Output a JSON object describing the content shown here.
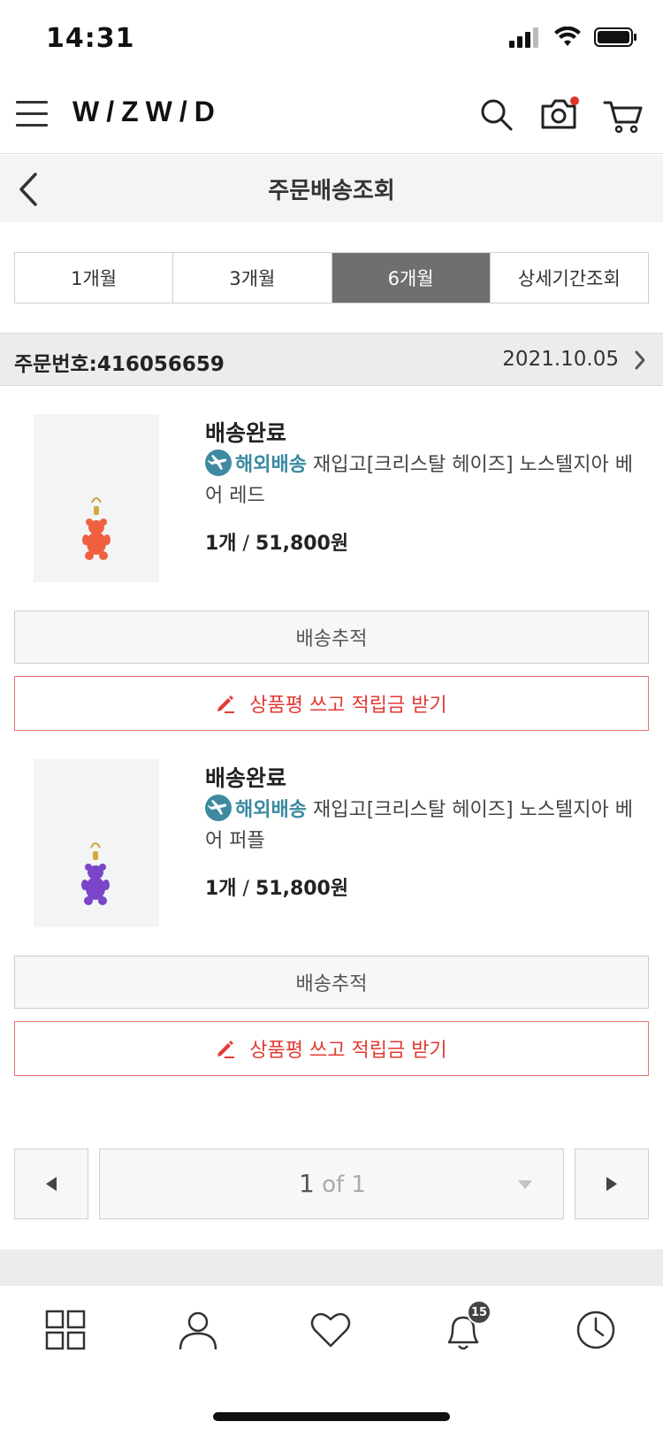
{
  "status_bar": {
    "time": "14:31"
  },
  "header": {
    "brand": "W/ZW/D"
  },
  "page": {
    "title": "주문배송조회"
  },
  "period_tabs": [
    {
      "label": "1개월",
      "active": false
    },
    {
      "label": "3개월",
      "active": false
    },
    {
      "label": "6개월",
      "active": true
    },
    {
      "label": "상세기간조회",
      "active": false
    }
  ],
  "order": {
    "number": "주문번호:416056659",
    "date": "2021.10.05"
  },
  "items": [
    {
      "status": "배송완료",
      "overseas_label": "해외배송",
      "name": "재입고[크리스탈 헤이즈] 노스텔지아 베어 레드",
      "qty": "1개",
      "price": "51,800원",
      "bear_color": "#f06040",
      "track_label": "배송추적",
      "review_label": "상품평 쓰고 적립금 받기"
    },
    {
      "status": "배송완료",
      "overseas_label": "해외배송",
      "name": "재입고[크리스탈 헤이즈] 노스텔지아 베어 퍼플",
      "qty": "1개",
      "price": "51,800원",
      "bear_color": "#7a45c8",
      "track_label": "배송추적",
      "review_label": "상품평 쓰고 적립금 받기"
    }
  ],
  "pagination": {
    "current": "1",
    "total_text": "of 1"
  },
  "bottom_nav": {
    "notification_count": "15"
  },
  "colors": {
    "accent_red": "#e23b34",
    "overseas_teal": "#3a8aa1",
    "active_tab": "#6f6f6f"
  }
}
